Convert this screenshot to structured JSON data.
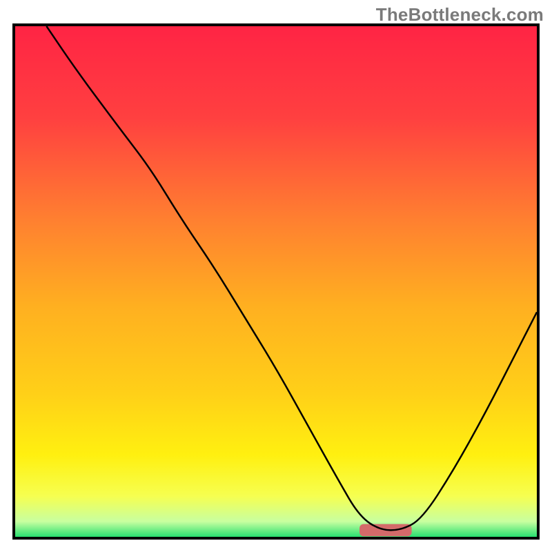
{
  "watermark": "TheBottleneck.com",
  "chart_data": {
    "type": "line",
    "title": "",
    "xlabel": "",
    "ylabel": "",
    "xlim": [
      0,
      100
    ],
    "ylim": [
      0,
      100
    ],
    "background_gradient_stops": [
      {
        "offset": 0.0,
        "color": "#ff2444"
      },
      {
        "offset": 0.18,
        "color": "#ff4040"
      },
      {
        "offset": 0.38,
        "color": "#ff8030"
      },
      {
        "offset": 0.55,
        "color": "#ffb020"
      },
      {
        "offset": 0.72,
        "color": "#ffd018"
      },
      {
        "offset": 0.84,
        "color": "#fff010"
      },
      {
        "offset": 0.92,
        "color": "#f6ff50"
      },
      {
        "offset": 0.97,
        "color": "#c8ffa0"
      },
      {
        "offset": 1.0,
        "color": "#28e070"
      }
    ],
    "series": [
      {
        "name": "bottleneck-curve",
        "type": "curve",
        "color": "#000000",
        "width": 2.5,
        "points": [
          {
            "x": 6.0,
            "y": 100.0
          },
          {
            "x": 12.0,
            "y": 91.0
          },
          {
            "x": 20.0,
            "y": 80.0
          },
          {
            "x": 26.0,
            "y": 72.0
          },
          {
            "x": 32.0,
            "y": 62.0
          },
          {
            "x": 38.0,
            "y": 53.0
          },
          {
            "x": 44.0,
            "y": 43.0
          },
          {
            "x": 50.0,
            "y": 33.0
          },
          {
            "x": 56.0,
            "y": 22.0
          },
          {
            "x": 62.0,
            "y": 11.0
          },
          {
            "x": 66.0,
            "y": 4.0
          },
          {
            "x": 70.0,
            "y": 1.3
          },
          {
            "x": 74.0,
            "y": 1.3
          },
          {
            "x": 78.0,
            "y": 3.5
          },
          {
            "x": 84.0,
            "y": 13.0
          },
          {
            "x": 90.0,
            "y": 24.0
          },
          {
            "x": 96.0,
            "y": 36.0
          },
          {
            "x": 100.0,
            "y": 44.0
          }
        ]
      },
      {
        "name": "optimal-marker",
        "type": "bar-marker",
        "color": "#d46a6a",
        "x_start": 66.0,
        "x_end": 76.0,
        "y": 1.3,
        "thickness": 2.4
      }
    ]
  }
}
